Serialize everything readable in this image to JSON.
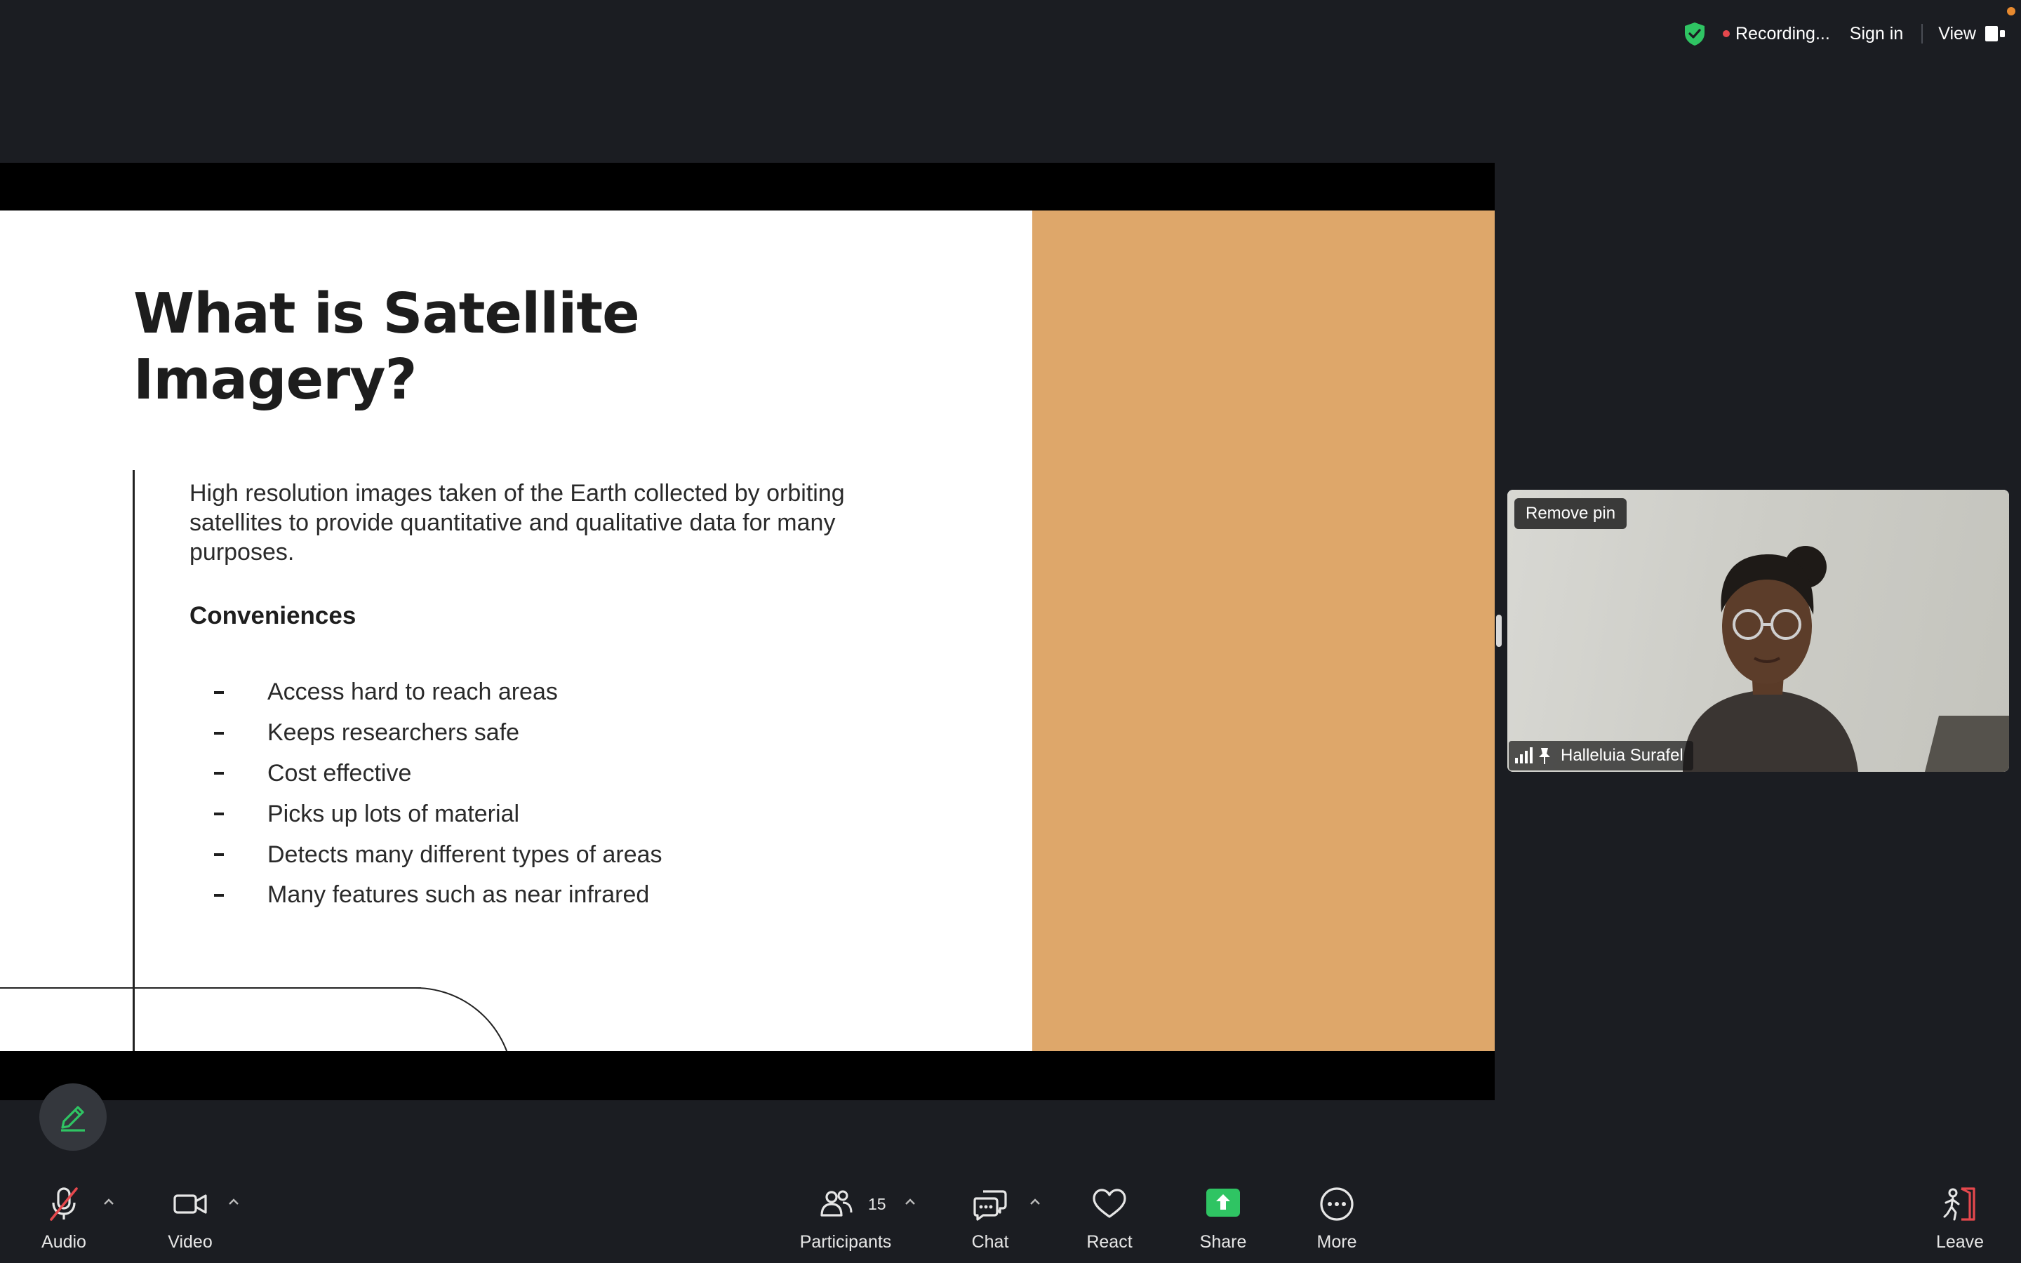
{
  "top_bar": {
    "recording_label": "Recording...",
    "sign_in_label": "Sign in",
    "view_label": "View"
  },
  "slide": {
    "title": "What is Satellite\nImagery?",
    "body": "High resolution images taken of the Earth collected by orbiting satellites to provide quantitative and qualitative data for many purposes.",
    "subheading": "Conveniences",
    "bullets": [
      "Access hard to reach areas",
      "Keeps researchers safe",
      "Cost effective",
      "Picks up lots of material",
      "Detects many different types of areas",
      "Many features such as near infrared"
    ],
    "accent_color": "#dea76a"
  },
  "video": {
    "pin_label": "Remove pin",
    "participant_name": "Halleluia Surafel"
  },
  "toolbar": {
    "audio_label": "Audio",
    "video_label": "Video",
    "participants_label": "Participants",
    "participants_count": "15",
    "chat_label": "Chat",
    "react_label": "React",
    "share_label": "Share",
    "more_label": "More",
    "leave_label": "Leave"
  },
  "colors": {
    "background": "#1b1d22",
    "share_green": "#2fc463",
    "mute_red": "#e5484d",
    "shield_green": "#2fc463"
  },
  "icons": [
    "shield-check-icon",
    "view-layout-icon",
    "signal-icon",
    "pin-icon",
    "pencil-icon",
    "microphone-muted-icon",
    "camera-icon",
    "participants-icon",
    "chat-icon",
    "heart-icon",
    "share-screen-icon",
    "more-icon",
    "leave-icon"
  ]
}
